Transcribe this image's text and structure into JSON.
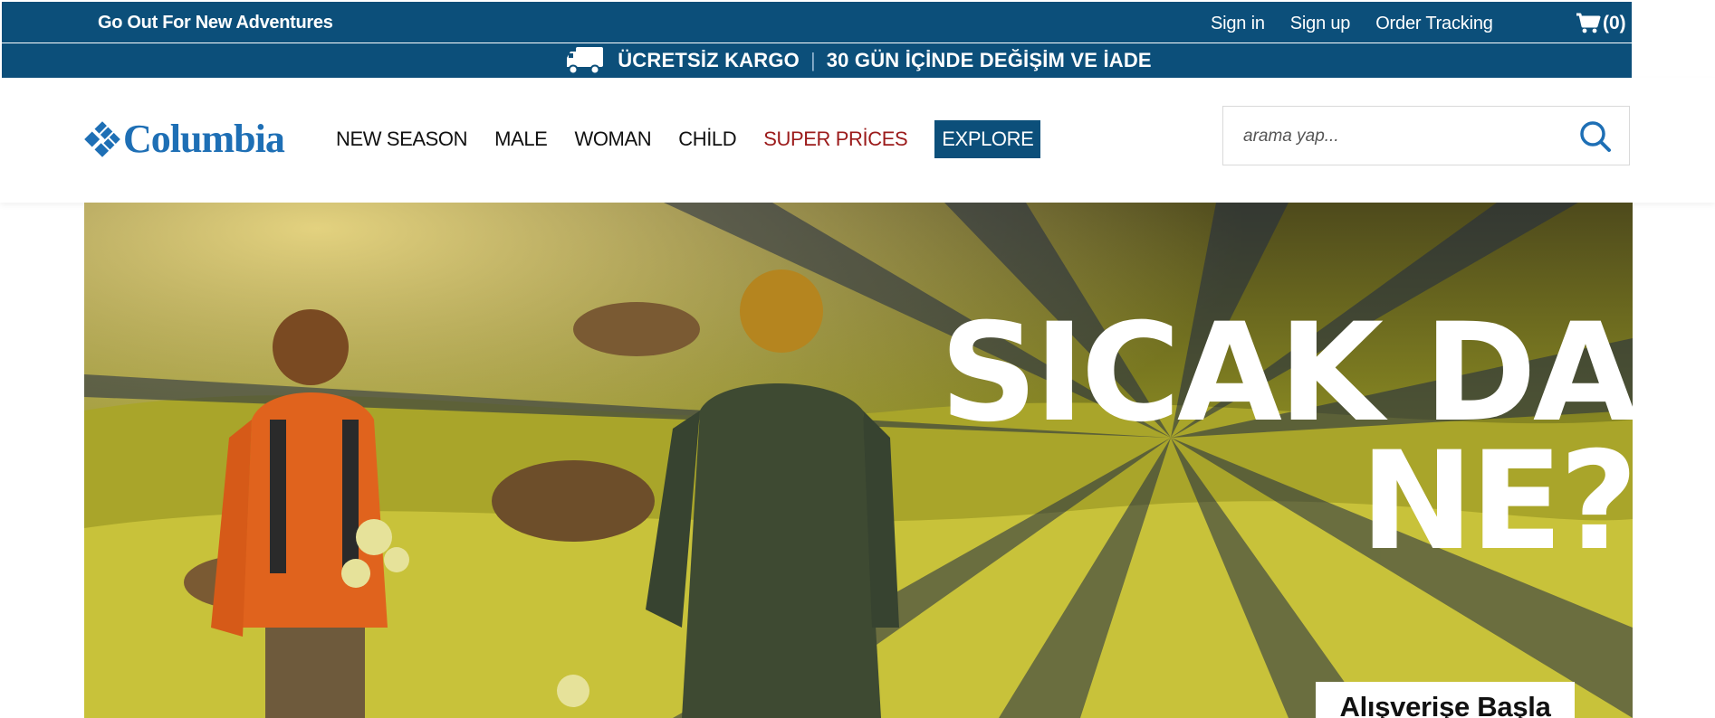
{
  "topbar": {
    "tagline": "Go Out For New Adventures",
    "links": [
      "Sign in",
      "Sign up",
      "Order Tracking"
    ],
    "cart_count": "(0)"
  },
  "promo": {
    "shipping": "ÜCRETSİZ KARGO",
    "separator": "|",
    "returns": "30 GÜN İÇİNDE DEĞİŞİM VE  İADE"
  },
  "header": {
    "logo_text": "Columbia",
    "nav": [
      "NEW SEASON",
      "MALE",
      "WOMAN",
      "CHİLD",
      "SUPER PRİCES",
      "EXPLORE"
    ],
    "search_placeholder": "arama yap..."
  },
  "hero": {
    "title_line1": "SICAK DA",
    "title_line2": "NE?",
    "cta": "Alışverişe Başla"
  },
  "colors": {
    "brand_blue": "#0c4f7a",
    "logo_blue": "#1e6fb5",
    "sale_red": "#9b1a1a"
  },
  "icons": [
    "cart-icon",
    "truck-icon",
    "search-icon",
    "columbia-diamond-icon"
  ]
}
